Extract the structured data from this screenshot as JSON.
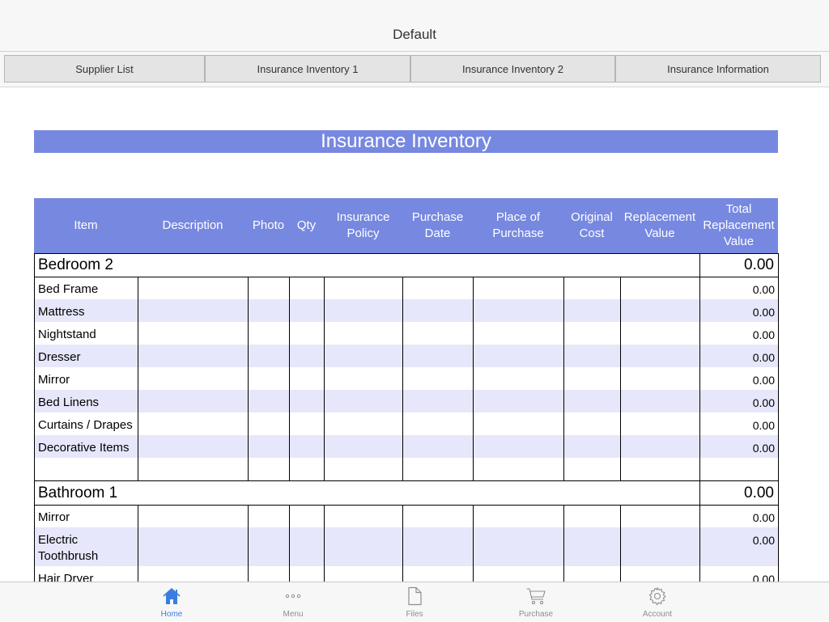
{
  "nav": {
    "title": "Default"
  },
  "tabs": [
    {
      "label": "Supplier List"
    },
    {
      "label": "Insurance Inventory 1"
    },
    {
      "label": "Insurance Inventory 2"
    },
    {
      "label": "Insurance Information"
    }
  ],
  "sheet": {
    "title": "Insurance Inventory",
    "columns": [
      "Item",
      "Description",
      "Photo",
      "Qty",
      "Insurance Policy",
      "Purchase Date",
      "Place of Purchase",
      "Original Cost",
      "Replacement Value",
      "Total Replacement Value"
    ],
    "sections": [
      {
        "name": "Bedroom 2",
        "total": "0.00",
        "rows": [
          {
            "item": "Bed Frame",
            "total": "0.00"
          },
          {
            "item": "Mattress",
            "total": "0.00"
          },
          {
            "item": "Nightstand",
            "total": "0.00"
          },
          {
            "item": "Dresser",
            "total": "0.00"
          },
          {
            "item": "Mirror",
            "total": "0.00"
          },
          {
            "item": "Bed Linens",
            "total": "0.00"
          },
          {
            "item": "Curtains / Drapes",
            "total": "0.00"
          },
          {
            "item": "Decorative Items",
            "total": "0.00"
          },
          {
            "item": "",
            "total": ""
          }
        ]
      },
      {
        "name": "Bathroom 1",
        "total": "0.00",
        "rows": [
          {
            "item": "Mirror",
            "total": "0.00"
          },
          {
            "item": "Electric Toothbrush",
            "total": "0.00"
          },
          {
            "item": "Hair Dryer",
            "total": "0.00"
          }
        ]
      }
    ]
  },
  "tabbar": [
    {
      "label": "Home",
      "icon": "home-icon",
      "active": true
    },
    {
      "label": "Menu",
      "icon": "more-dots-icon",
      "active": false
    },
    {
      "label": "Files",
      "icon": "file-icon",
      "active": false
    },
    {
      "label": "Purchase",
      "icon": "cart-icon",
      "active": false
    },
    {
      "label": "Account",
      "icon": "gear-icon",
      "active": false
    }
  ],
  "colors": {
    "accent": "#7788e0",
    "alt_row": "#e6e7fa",
    "active_tab": "#3a7de0"
  }
}
